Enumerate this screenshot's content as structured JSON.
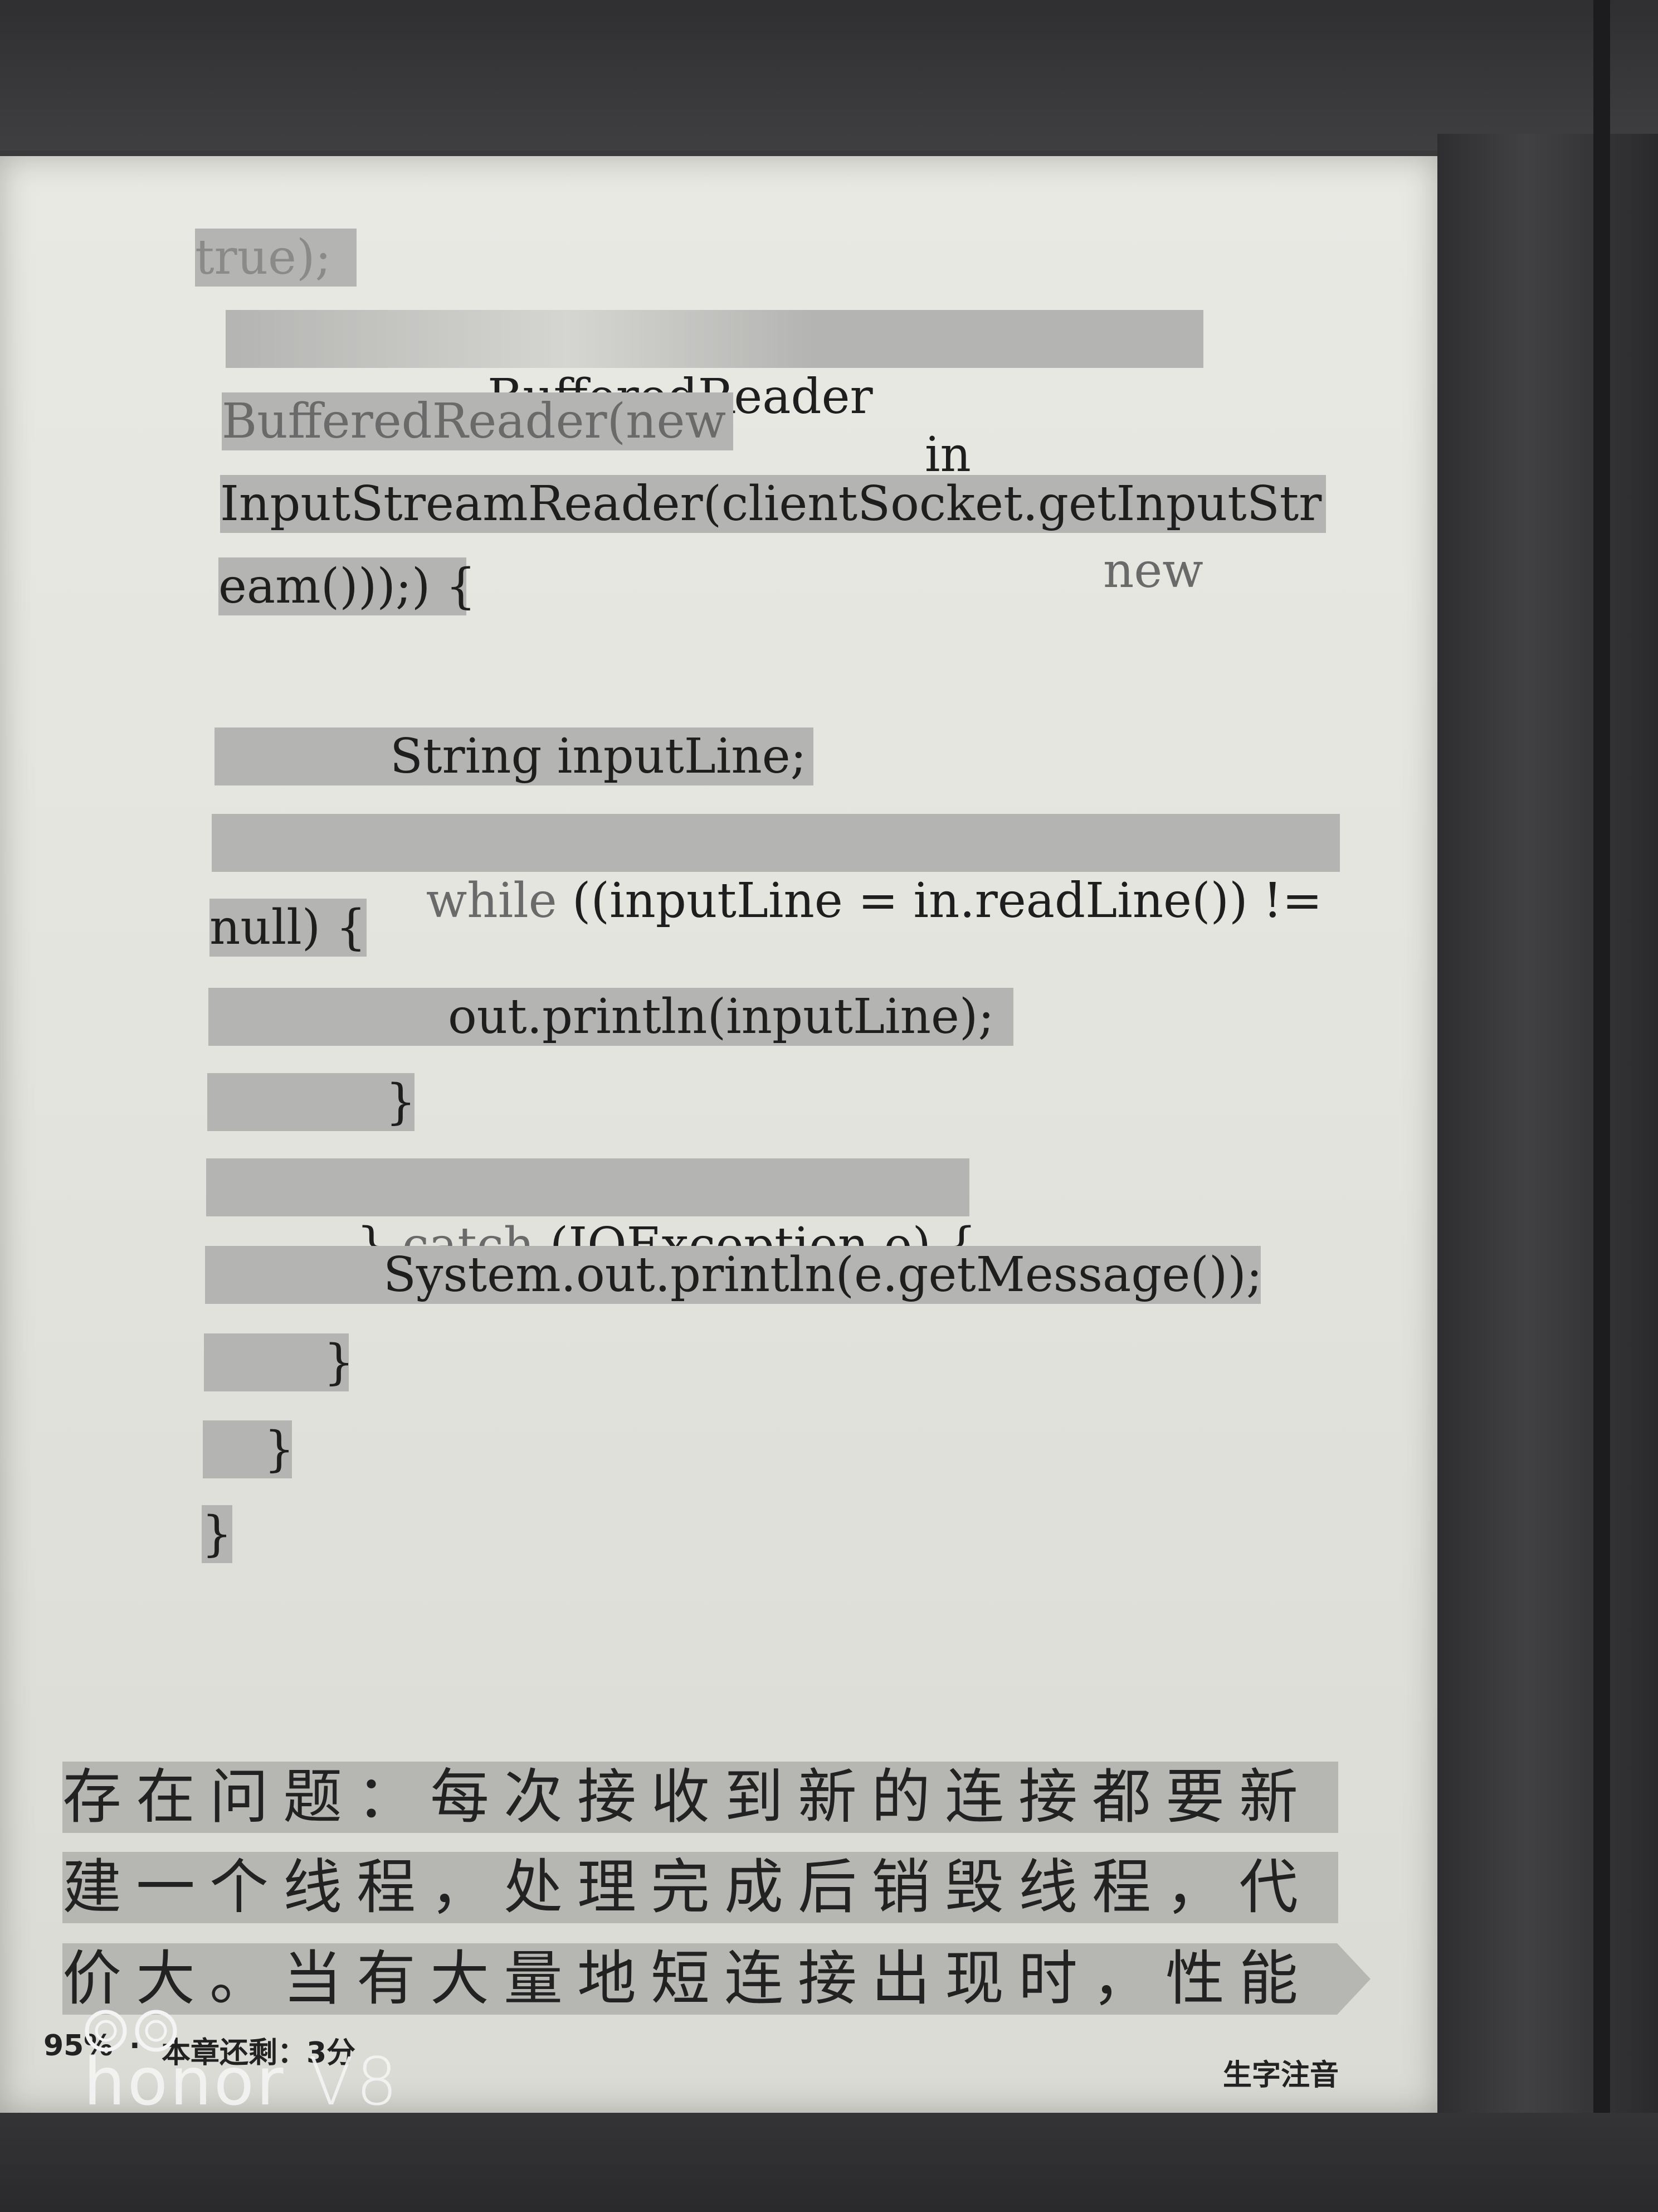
{
  "code": {
    "line_true": "true);",
    "line_br1_kw1": "BufferedReader",
    "line_br1_in": "in",
    "line_br1_eq": "=",
    "line_br1_new": "new",
    "line_br2": "BufferedReader(",
    "line_br2_new": "new",
    "line_isr": "InputStreamReader(clientSocket.getInputStr",
    "line_eam": "eam()));) {",
    "line_string": "String inputLine;",
    "line_while_kw": "while",
    "line_while_rest": " ((inputLine = in.readLine()) !=",
    "line_null": "null) {",
    "line_println": "out.println(inputLine);",
    "line_close1": "}",
    "line_catch_pre": "} ",
    "line_catch_kw": "catch",
    "line_catch_rest": " (IOException e) {",
    "line_sysout": "System.out.println(e.getMessage());",
    "line_close2": "}",
    "line_close3": "}",
    "line_close4": "}"
  },
  "body_text": {
    "line1": "存在问题：每次接收到新的连接都要新",
    "line2": "建一个线程，处理完成后销毁线程，代",
    "line3": "价大。当有大量地短连接出现时，性能"
  },
  "status_bar": {
    "progress": "95%",
    "separator": "·",
    "chapter_remaining": "本章还剩：3分",
    "pinyin_button": "生字注音"
  },
  "watermark": {
    "brand": "honor",
    "model": "V8"
  }
}
